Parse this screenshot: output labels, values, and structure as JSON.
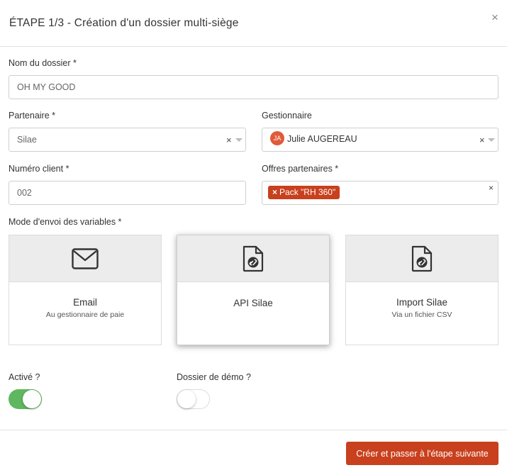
{
  "header": {
    "title": "ÉTAPE 1/3 - Création d'un dossier multi-siège",
    "close_label": "×"
  },
  "form": {
    "folder_name": {
      "label": "Nom du dossier *",
      "value": "OH MY GOOD"
    },
    "partner": {
      "label": "Partenaire *",
      "value": "Silae",
      "clear": "×"
    },
    "manager": {
      "label": "Gestionnaire",
      "avatar_initials": "JA",
      "value": "Julie AUGEREAU",
      "clear": "×"
    },
    "client_number": {
      "label": "Numéro client *",
      "value": "002"
    },
    "partner_offers": {
      "label": "Offres partenaires *",
      "tags": [
        {
          "remove": "×",
          "label": "Pack \"RH 360\""
        }
      ],
      "clear": "×"
    },
    "send_mode": {
      "label": "Mode d'envoi des variables *",
      "options": [
        {
          "title": "Email",
          "subtitle": "Au gestionnaire de paie",
          "icon": "envelope-icon"
        },
        {
          "title": "API Silae",
          "subtitle": "",
          "icon": "document-link-icon",
          "selected": true
        },
        {
          "title": "Import Silae",
          "subtitle": "Via un fichier CSV",
          "icon": "document-link-icon"
        }
      ]
    },
    "active": {
      "label": "Activé ?",
      "on": true
    },
    "demo": {
      "label": "Dossier de démo ?",
      "on": false
    }
  },
  "footer": {
    "submit_label": "Créer et passer à l'étape suivante"
  },
  "colors": {
    "primary": "#c8401d",
    "toggle_on": "#5fb75f",
    "avatar": "#e05a3a"
  }
}
